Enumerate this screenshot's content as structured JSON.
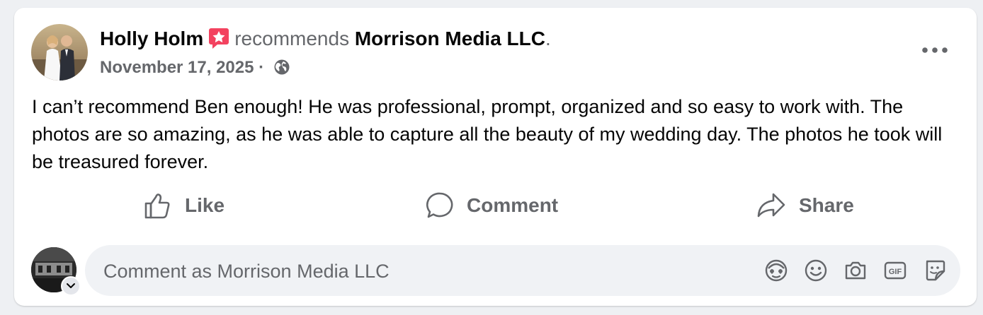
{
  "post": {
    "author_name": "Holly Holm",
    "verb": "recommends",
    "page_name": "Morrison Media LLC",
    "period": ".",
    "date": "November 17, 2025",
    "date_separator": "·",
    "privacy_icon": "globe-icon",
    "body": "I can’t recommend Ben enough! He was professional, prompt, organized and so easy to work with. The photos are so amazing, as he was able to capture all the beauty of my wedding day. The photos he took will be treasured forever."
  },
  "actions": {
    "like": "Like",
    "comment": "Comment",
    "share": "Share"
  },
  "composer": {
    "placeholder": "Comment as Morrison Media LLC",
    "tools": [
      "avatar-sticker-icon",
      "emoji-icon",
      "camera-icon",
      "gif-icon",
      "sticker-icon"
    ]
  },
  "colors": {
    "secondary_text": "#65676b",
    "recommend_badge": "#f3425f",
    "input_background": "#f0f2f5"
  }
}
